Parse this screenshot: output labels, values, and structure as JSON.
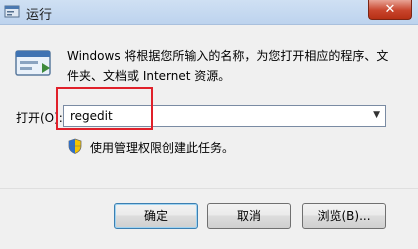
{
  "window": {
    "title": "运行",
    "close_label": "✕"
  },
  "body": {
    "description": "Windows 将根据您所输入的名称，为您打开相应的程序、文件夹、文档或 Internet 资源。",
    "open_label": "打开(O):",
    "open_value": "regedit",
    "admin_note": "使用管理权限创建此任务。"
  },
  "buttons": {
    "ok": "确定",
    "cancel": "取消",
    "browse": "浏览(B)..."
  },
  "colors": {
    "highlight": "#e0202a",
    "close": "#c8442c"
  }
}
